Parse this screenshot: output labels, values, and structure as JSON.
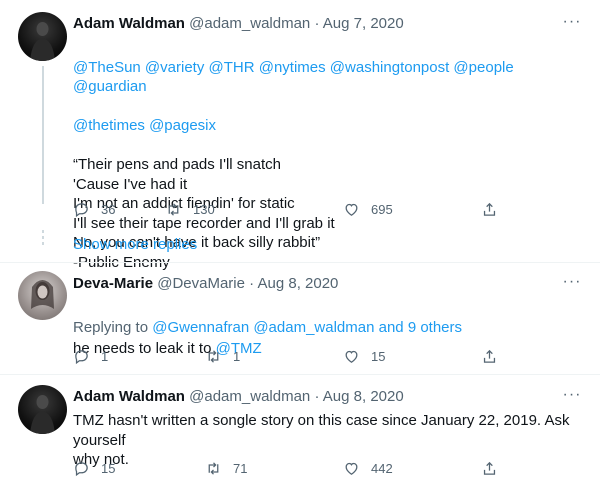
{
  "tweets": [
    {
      "name": "Adam Waldman",
      "handle": "@adam_waldman",
      "date": "Aug 7, 2020",
      "mentions_line1": "@TheSun @variety @THR @nytimes @washingtonpost @people @guardian",
      "mentions_line2": "@thetimes @pagesix",
      "body": "“Their pens and pads I'll snatch\n'Cause I've had it\nI'm not an addict fiendin' for static\nI'll see their tape recorder and I'll grab it\nNo, you can't have it back silly rabbit”\n-Public Enemy",
      "replies": "36",
      "retweets": "130",
      "likes": "695"
    },
    {
      "name": "Deva-Marie",
      "handle": "@DevaMarie",
      "date": "Aug 8, 2020",
      "replying_prefix": "Replying to ",
      "replying_users": "@Gwennafran @adam_waldman",
      "replying_suffix": " and 9 others",
      "body_text": "he needs to leak it to ",
      "body_mention": "@TMZ",
      "replies": "1",
      "retweets": "1",
      "likes": "15"
    },
    {
      "name": "Adam Waldman",
      "handle": "@adam_waldman",
      "date": "Aug 8, 2020",
      "body": "TMZ hasn't written a songle story on this case since January 22, 2019.  Ask yourself\nwhy not.",
      "replies": "15",
      "retweets": "71",
      "likes": "442"
    }
  ],
  "show_more": "Show more replies",
  "more_glyph": "···",
  "separator": "·",
  "colors": {
    "accent": "#1d9bf0",
    "muted": "#536471",
    "text": "#0f1419"
  }
}
